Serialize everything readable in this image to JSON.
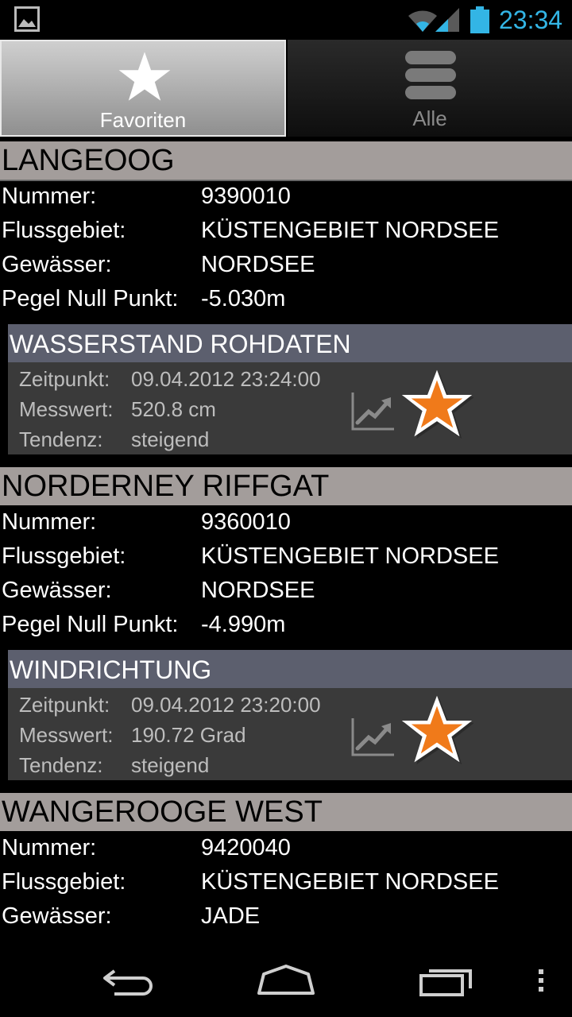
{
  "status_bar": {
    "time": "23:34",
    "icons": [
      "image-notification-icon",
      "wifi-icon",
      "signal-icon",
      "battery-icon"
    ],
    "accent_color": "#33b5e5"
  },
  "tabs": [
    {
      "label": "Favoriten",
      "icon": "star-icon",
      "selected": true
    },
    {
      "label": "Alle",
      "icon": "list-icon",
      "selected": false
    }
  ],
  "labels": {
    "nummer": "Nummer:",
    "flussgebiet": "Flussgebiet:",
    "gewaesser": "Gewässer:",
    "pegel": "Pegel Null Punkt:",
    "zeitpunkt": "Zeitpunkt:",
    "messwert": "Messwert:",
    "tendenz": "Tendenz:"
  },
  "stations": [
    {
      "name": "LANGEOOG",
      "nummer": "9390010",
      "flussgebiet": "KÜSTENGEBIET NORDSEE",
      "gewaesser": "NORDSEE",
      "pegel": "-5.030m",
      "measurement": {
        "title": "WASSERSTAND ROHDATEN",
        "zeitpunkt": "09.04.2012 23:24:00",
        "messwert": "520.8 cm",
        "tendenz": "steigend"
      }
    },
    {
      "name": "NORDERNEY RIFFGAT",
      "nummer": "9360010",
      "flussgebiet": "KÜSTENGEBIET NORDSEE",
      "gewaesser": "NORDSEE",
      "pegel": "-4.990m",
      "measurement": {
        "title": "WINDRICHTUNG",
        "zeitpunkt": "09.04.2012 23:20:00",
        "messwert": "190.72 Grad",
        "tendenz": "steigend"
      }
    },
    {
      "name": "WANGEROOGE WEST",
      "nummer": "9420040",
      "flussgebiet": "KÜSTENGEBIET NORDSEE",
      "gewaesser": "JADE"
    }
  ],
  "colors": {
    "station_header": "#a39d9b",
    "measure_header": "#5c5f6e",
    "measure_body": "#3a3a3a",
    "favorite_star": "#f07a1a"
  },
  "nav_bar": {
    "icons": [
      "back-icon",
      "home-icon",
      "recent-apps-icon",
      "menu-icon"
    ]
  }
}
